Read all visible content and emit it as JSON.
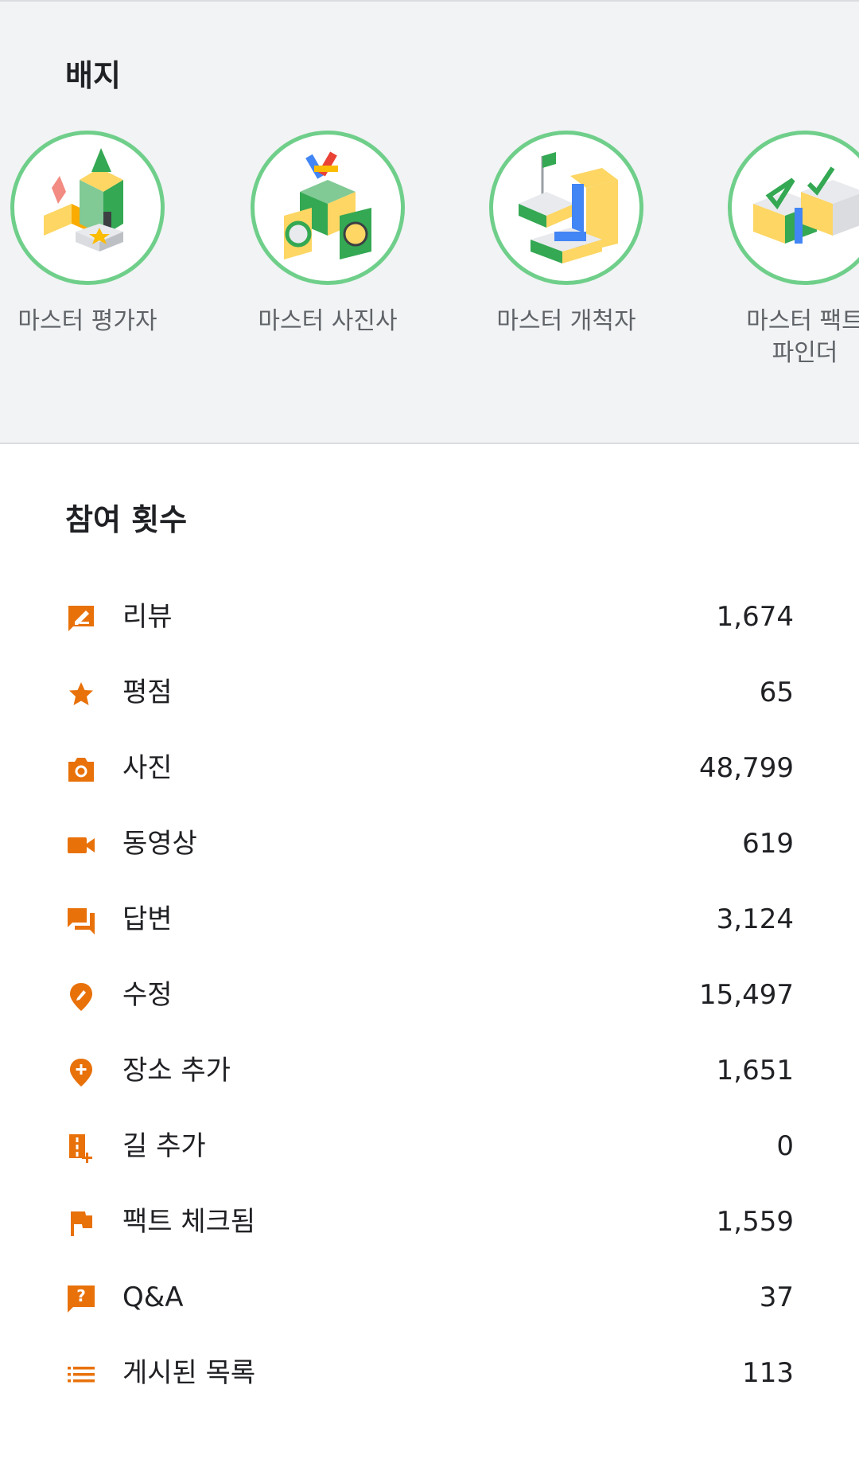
{
  "badges": {
    "title": "배지",
    "items": [
      {
        "name": "마스터 평가자",
        "icon": "reviewer-badge-icon"
      },
      {
        "name": "마스터 사진사",
        "icon": "photographer-badge-icon"
      },
      {
        "name": "마스터 개척자",
        "icon": "trailblazer-badge-icon"
      },
      {
        "name": "마스터 팩트\n파인더",
        "icon": "fact-finder-badge-icon"
      }
    ]
  },
  "contributions": {
    "title": "참여 횟수",
    "accent_color": "#e8710a",
    "rows": [
      {
        "label": "리뷰",
        "count": "1,674",
        "icon": "review-icon"
      },
      {
        "label": "평점",
        "count": "65",
        "icon": "star-icon"
      },
      {
        "label": "사진",
        "count": "48,799",
        "icon": "camera-icon"
      },
      {
        "label": "동영상",
        "count": "619",
        "icon": "video-icon"
      },
      {
        "label": "답변",
        "count": "3,124",
        "icon": "answer-icon"
      },
      {
        "label": "수정",
        "count": "15,497",
        "icon": "edit-pin-icon"
      },
      {
        "label": "장소 추가",
        "count": "1,651",
        "icon": "add-place-icon"
      },
      {
        "label": "길 추가",
        "count": "0",
        "icon": "add-road-icon"
      },
      {
        "label": "팩트 체크됨",
        "count": "1,559",
        "icon": "flag-icon"
      },
      {
        "label": "Q&A",
        "count": "37",
        "icon": "qa-icon"
      },
      {
        "label": "게시된 목록",
        "count": "113",
        "icon": "list-icon"
      }
    ]
  }
}
